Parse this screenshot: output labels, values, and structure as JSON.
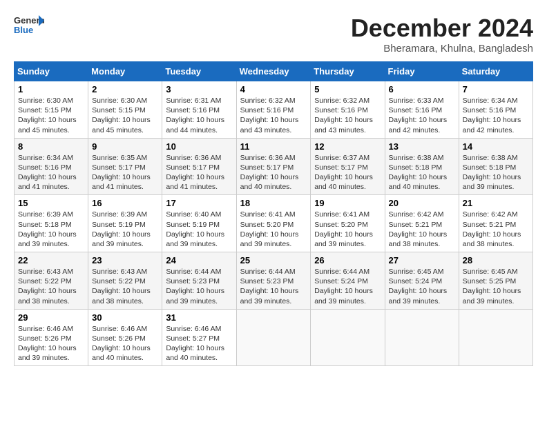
{
  "header": {
    "logo_general": "General",
    "logo_blue": "Blue",
    "month_title": "December 2024",
    "location": "Bheramara, Khulna, Bangladesh"
  },
  "columns": [
    "Sunday",
    "Monday",
    "Tuesday",
    "Wednesday",
    "Thursday",
    "Friday",
    "Saturday"
  ],
  "weeks": [
    [
      {
        "day": "1",
        "sunrise": "Sunrise: 6:30 AM",
        "sunset": "Sunset: 5:15 PM",
        "daylight": "Daylight: 10 hours and 45 minutes."
      },
      {
        "day": "2",
        "sunrise": "Sunrise: 6:30 AM",
        "sunset": "Sunset: 5:15 PM",
        "daylight": "Daylight: 10 hours and 45 minutes."
      },
      {
        "day": "3",
        "sunrise": "Sunrise: 6:31 AM",
        "sunset": "Sunset: 5:16 PM",
        "daylight": "Daylight: 10 hours and 44 minutes."
      },
      {
        "day": "4",
        "sunrise": "Sunrise: 6:32 AM",
        "sunset": "Sunset: 5:16 PM",
        "daylight": "Daylight: 10 hours and 43 minutes."
      },
      {
        "day": "5",
        "sunrise": "Sunrise: 6:32 AM",
        "sunset": "Sunset: 5:16 PM",
        "daylight": "Daylight: 10 hours and 43 minutes."
      },
      {
        "day": "6",
        "sunrise": "Sunrise: 6:33 AM",
        "sunset": "Sunset: 5:16 PM",
        "daylight": "Daylight: 10 hours and 42 minutes."
      },
      {
        "day": "7",
        "sunrise": "Sunrise: 6:34 AM",
        "sunset": "Sunset: 5:16 PM",
        "daylight": "Daylight: 10 hours and 42 minutes."
      }
    ],
    [
      {
        "day": "8",
        "sunrise": "Sunrise: 6:34 AM",
        "sunset": "Sunset: 5:16 PM",
        "daylight": "Daylight: 10 hours and 41 minutes."
      },
      {
        "day": "9",
        "sunrise": "Sunrise: 6:35 AM",
        "sunset": "Sunset: 5:17 PM",
        "daylight": "Daylight: 10 hours and 41 minutes."
      },
      {
        "day": "10",
        "sunrise": "Sunrise: 6:36 AM",
        "sunset": "Sunset: 5:17 PM",
        "daylight": "Daylight: 10 hours and 41 minutes."
      },
      {
        "day": "11",
        "sunrise": "Sunrise: 6:36 AM",
        "sunset": "Sunset: 5:17 PM",
        "daylight": "Daylight: 10 hours and 40 minutes."
      },
      {
        "day": "12",
        "sunrise": "Sunrise: 6:37 AM",
        "sunset": "Sunset: 5:17 PM",
        "daylight": "Daylight: 10 hours and 40 minutes."
      },
      {
        "day": "13",
        "sunrise": "Sunrise: 6:38 AM",
        "sunset": "Sunset: 5:18 PM",
        "daylight": "Daylight: 10 hours and 40 minutes."
      },
      {
        "day": "14",
        "sunrise": "Sunrise: 6:38 AM",
        "sunset": "Sunset: 5:18 PM",
        "daylight": "Daylight: 10 hours and 39 minutes."
      }
    ],
    [
      {
        "day": "15",
        "sunrise": "Sunrise: 6:39 AM",
        "sunset": "Sunset: 5:18 PM",
        "daylight": "Daylight: 10 hours and 39 minutes."
      },
      {
        "day": "16",
        "sunrise": "Sunrise: 6:39 AM",
        "sunset": "Sunset: 5:19 PM",
        "daylight": "Daylight: 10 hours and 39 minutes."
      },
      {
        "day": "17",
        "sunrise": "Sunrise: 6:40 AM",
        "sunset": "Sunset: 5:19 PM",
        "daylight": "Daylight: 10 hours and 39 minutes."
      },
      {
        "day": "18",
        "sunrise": "Sunrise: 6:41 AM",
        "sunset": "Sunset: 5:20 PM",
        "daylight": "Daylight: 10 hours and 39 minutes."
      },
      {
        "day": "19",
        "sunrise": "Sunrise: 6:41 AM",
        "sunset": "Sunset: 5:20 PM",
        "daylight": "Daylight: 10 hours and 39 minutes."
      },
      {
        "day": "20",
        "sunrise": "Sunrise: 6:42 AM",
        "sunset": "Sunset: 5:21 PM",
        "daylight": "Daylight: 10 hours and 38 minutes."
      },
      {
        "day": "21",
        "sunrise": "Sunrise: 6:42 AM",
        "sunset": "Sunset: 5:21 PM",
        "daylight": "Daylight: 10 hours and 38 minutes."
      }
    ],
    [
      {
        "day": "22",
        "sunrise": "Sunrise: 6:43 AM",
        "sunset": "Sunset: 5:22 PM",
        "daylight": "Daylight: 10 hours and 38 minutes."
      },
      {
        "day": "23",
        "sunrise": "Sunrise: 6:43 AM",
        "sunset": "Sunset: 5:22 PM",
        "daylight": "Daylight: 10 hours and 38 minutes."
      },
      {
        "day": "24",
        "sunrise": "Sunrise: 6:44 AM",
        "sunset": "Sunset: 5:23 PM",
        "daylight": "Daylight: 10 hours and 39 minutes."
      },
      {
        "day": "25",
        "sunrise": "Sunrise: 6:44 AM",
        "sunset": "Sunset: 5:23 PM",
        "daylight": "Daylight: 10 hours and 39 minutes."
      },
      {
        "day": "26",
        "sunrise": "Sunrise: 6:44 AM",
        "sunset": "Sunset: 5:24 PM",
        "daylight": "Daylight: 10 hours and 39 minutes."
      },
      {
        "day": "27",
        "sunrise": "Sunrise: 6:45 AM",
        "sunset": "Sunset: 5:24 PM",
        "daylight": "Daylight: 10 hours and 39 minutes."
      },
      {
        "day": "28",
        "sunrise": "Sunrise: 6:45 AM",
        "sunset": "Sunset: 5:25 PM",
        "daylight": "Daylight: 10 hours and 39 minutes."
      }
    ],
    [
      {
        "day": "29",
        "sunrise": "Sunrise: 6:46 AM",
        "sunset": "Sunset: 5:26 PM",
        "daylight": "Daylight: 10 hours and 39 minutes."
      },
      {
        "day": "30",
        "sunrise": "Sunrise: 6:46 AM",
        "sunset": "Sunset: 5:26 PM",
        "daylight": "Daylight: 10 hours and 40 minutes."
      },
      {
        "day": "31",
        "sunrise": "Sunrise: 6:46 AM",
        "sunset": "Sunset: 5:27 PM",
        "daylight": "Daylight: 10 hours and 40 minutes."
      },
      null,
      null,
      null,
      null
    ]
  ]
}
